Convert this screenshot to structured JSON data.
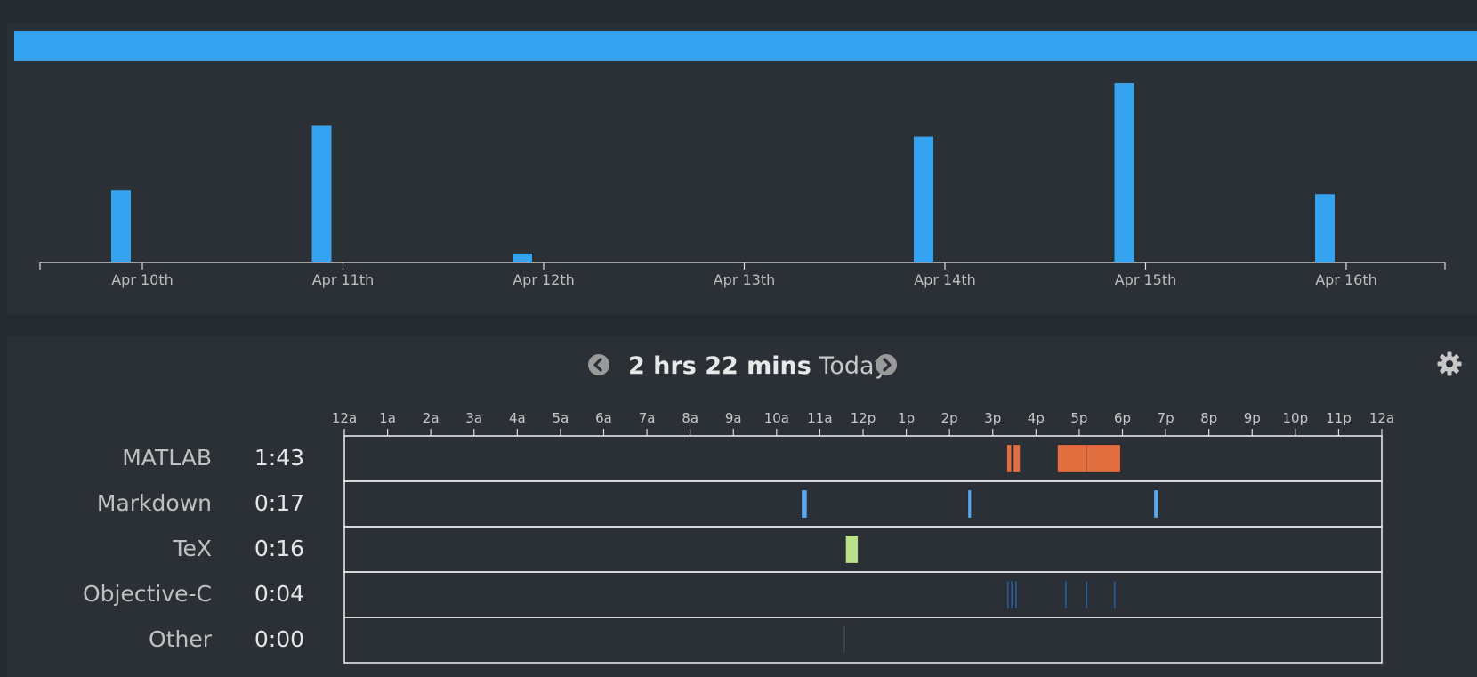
{
  "weekly_chart": {
    "chart_data": {
      "type": "bar",
      "categories": [
        "Apr 10th",
        "Apr 11th",
        "Apr 12th",
        "Apr 13th",
        "Apr 14th",
        "Apr 15th",
        "Apr 16th"
      ],
      "values": [
        0.4,
        0.76,
        0.05,
        0,
        0.7,
        1.0,
        0.38
      ],
      "xlabel": "",
      "ylabel": "",
      "bar_color": "#35a3ef"
    }
  },
  "day_nav": {
    "duration": "2 hrs 22 mins",
    "day": "Today",
    "prev_icon": "chevron-left-icon",
    "next_icon": "chevron-right-icon",
    "settings_icon": "gear-icon"
  },
  "timeline": {
    "hour_labels": [
      "12a",
      "1a",
      "2a",
      "3a",
      "4a",
      "5a",
      "6a",
      "7a",
      "8a",
      "9a",
      "10a",
      "11a",
      "12p",
      "1p",
      "2p",
      "3p",
      "4p",
      "5p",
      "6p",
      "7p",
      "8p",
      "9p",
      "10p",
      "11p",
      "12a"
    ],
    "rows": [
      {
        "label": "MATLAB",
        "time": "1:43",
        "color": "#e36f40",
        "segments": [
          [
            15.33,
            15.43
          ],
          [
            15.48,
            15.63
          ],
          [
            16.5,
            17.17
          ],
          [
            17.17,
            17.95
          ]
        ]
      },
      {
        "label": "Markdown",
        "time": "0:17",
        "color": "#5aa7ee",
        "segments": [
          [
            10.58,
            10.7
          ],
          [
            14.43,
            14.5
          ],
          [
            18.73,
            18.82
          ]
        ]
      },
      {
        "label": "TeX",
        "time": "0:16",
        "color": "#b9e08b",
        "segments": [
          [
            11.6,
            11.88
          ]
        ]
      },
      {
        "label": "Objective-C",
        "time": "0:04",
        "color": "#2e5f94",
        "segments": [
          [
            15.33,
            15.36
          ],
          [
            15.42,
            15.45
          ],
          [
            15.52,
            15.56
          ],
          [
            16.67,
            16.69
          ],
          [
            17.15,
            17.17
          ],
          [
            17.8,
            17.82
          ]
        ]
      },
      {
        "label": "Other",
        "time": "0:00",
        "color": "#3a4a5a",
        "segments": [
          [
            11.55,
            11.57
          ]
        ]
      }
    ]
  }
}
